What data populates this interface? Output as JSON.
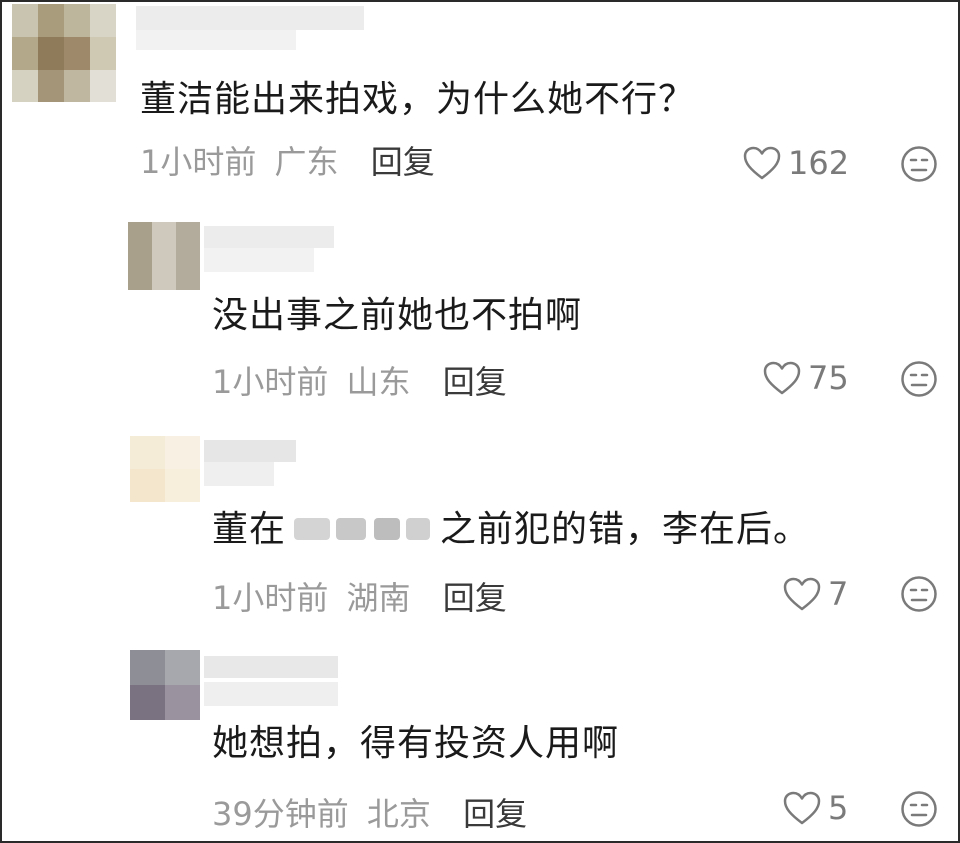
{
  "comments": [
    {
      "text": "董洁能出来拍戏，为什么她不行？",
      "time": "1小时前",
      "location": "广东",
      "reply_label": "回复",
      "likes": "162"
    },
    {
      "text": "没出事之前她也不拍啊",
      "time": "1小时前",
      "location": "山东",
      "reply_label": "回复",
      "likes": "75"
    },
    {
      "text_before": "董在",
      "text_after": "之前犯的错，李在后。",
      "time": "1小时前",
      "location": "湖南",
      "reply_label": "回复",
      "likes": "7"
    },
    {
      "text": "她想拍，得有投资人用啊",
      "time": "39分钟前",
      "location": "北京",
      "reply_label": "回复",
      "likes": "5"
    }
  ],
  "icons": {
    "like": "heart-outline-icon",
    "react": "neutral-face-icon"
  },
  "colors": {
    "text": "#1a1a1a",
    "meta": "#9a9a9a",
    "reply": "#3a3a3a",
    "icon": "#7a7a7a"
  }
}
